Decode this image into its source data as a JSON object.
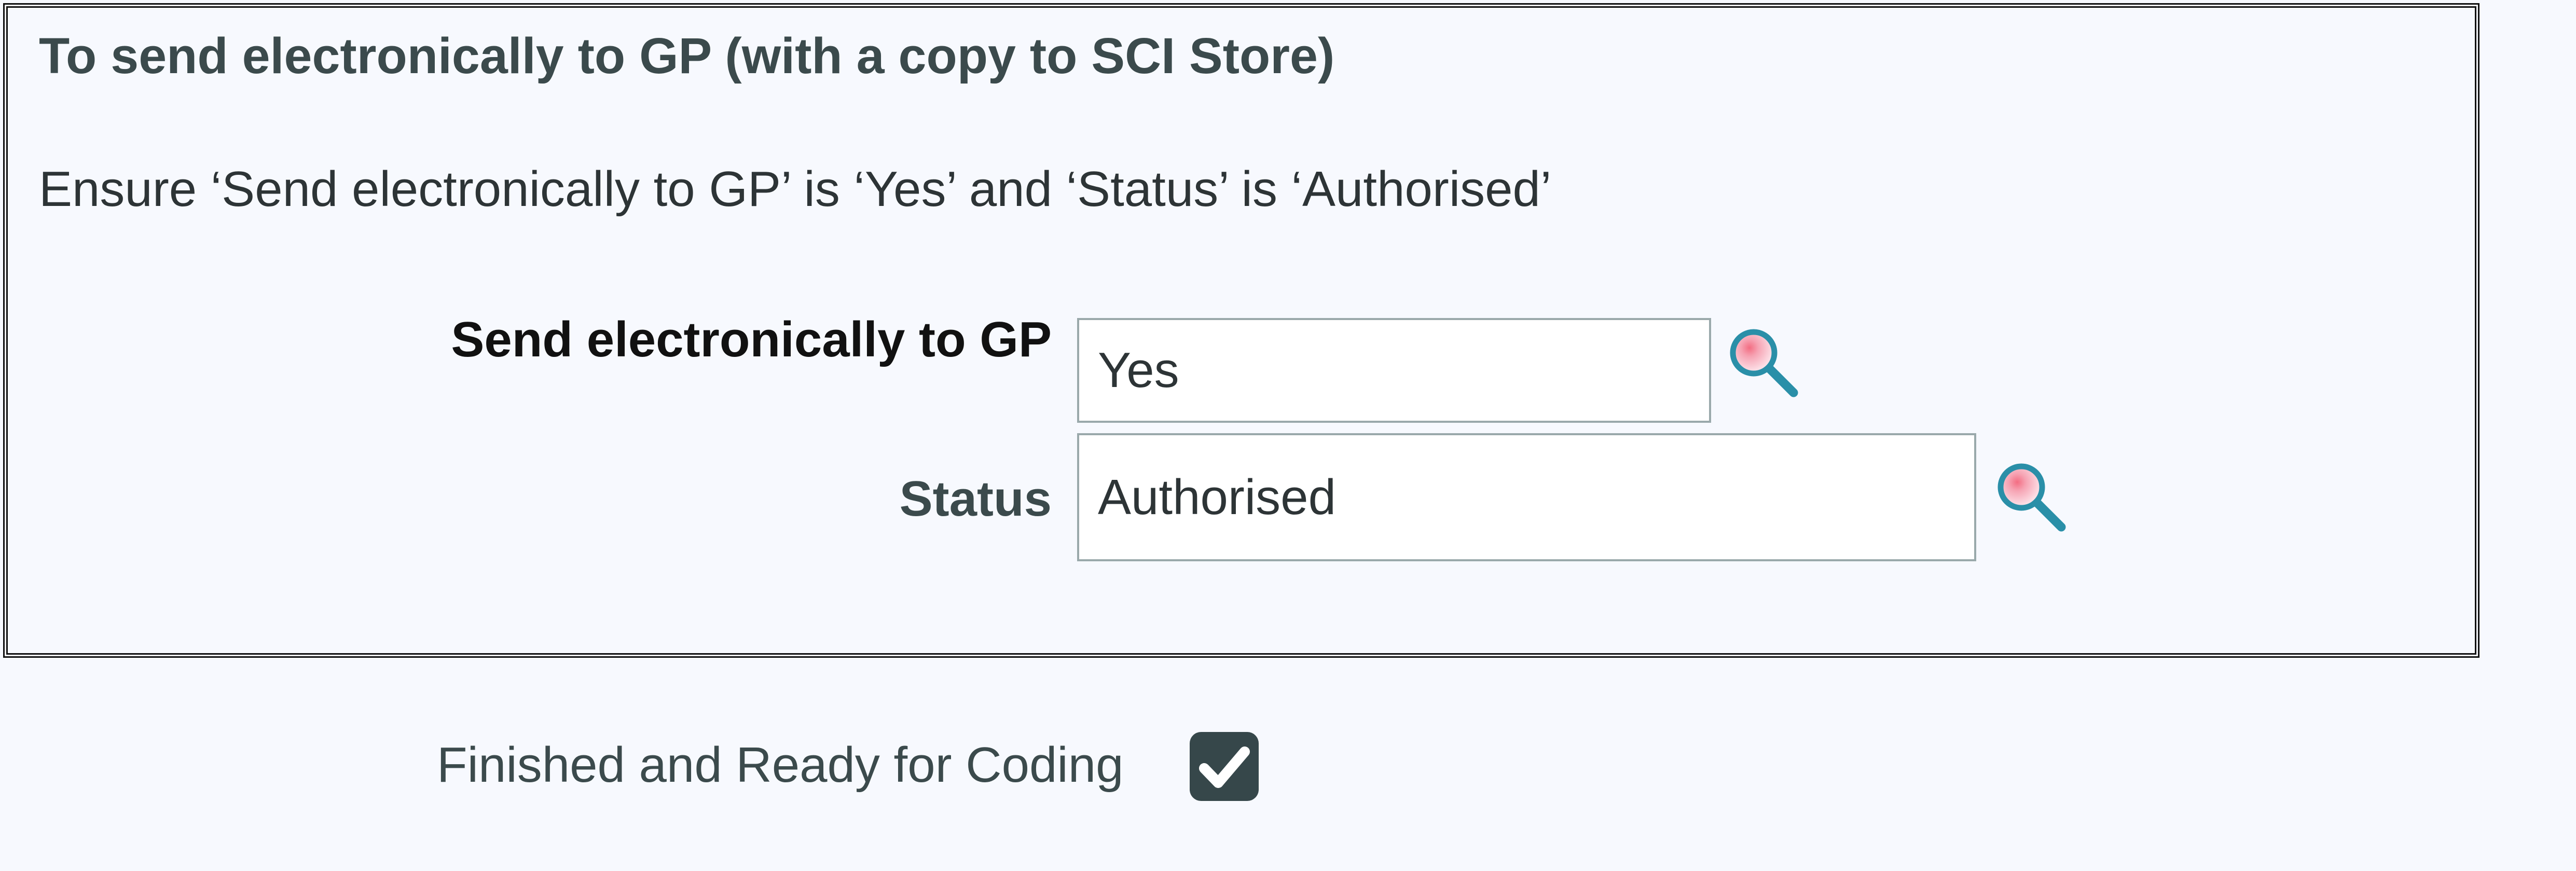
{
  "panel": {
    "title": "To send electronically to GP (with a copy to SCI Store)",
    "instruction": "Ensure ‘Send electronically to GP’ is ‘Yes’ and ‘Status’ is ‘Authorised’"
  },
  "fields": {
    "send_electronically": {
      "label": "Send electronically to GP",
      "value": "Yes",
      "lookup_icon": "magnifier-lookup-icon"
    },
    "status": {
      "label": "Status",
      "value": "Authorised",
      "lookup_icon": "magnifier-lookup-icon"
    }
  },
  "finished": {
    "label": "Finished and Ready for Coding",
    "checked": true,
    "icon": "checkmark-icon"
  },
  "colors": {
    "background": "#f7f9fe",
    "checkbox": "#36474a",
    "lookup_ring": "#2a8fa8",
    "lookup_highlight": "#f4a0b0"
  }
}
